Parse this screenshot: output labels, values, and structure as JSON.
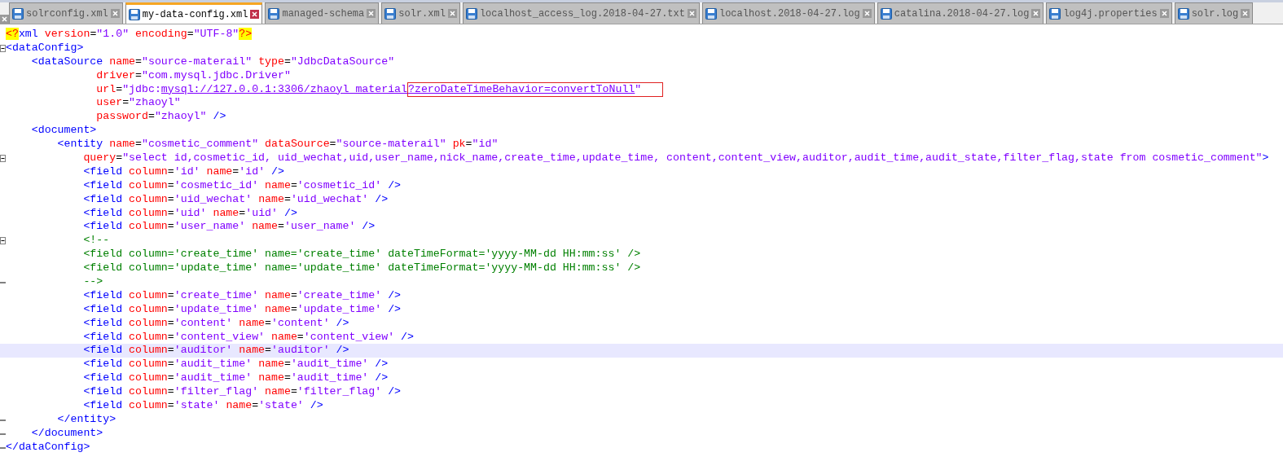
{
  "tabs": [
    {
      "label": "solrconfig.xml",
      "selected": false
    },
    {
      "label": "my-data-config.xml",
      "selected": true
    },
    {
      "label": "managed-schema",
      "selected": false
    },
    {
      "label": "solr.xml",
      "selected": false
    },
    {
      "label": "localhost_access_log.2018-04-27.txt",
      "selected": false
    },
    {
      "label": "localhost.2018-04-27.log",
      "selected": false
    },
    {
      "label": "catalina.2018-04-27.log",
      "selected": false
    },
    {
      "label": "log4j.properties",
      "selected": false
    },
    {
      "label": "solr.log",
      "selected": false
    }
  ],
  "lines": [
    {
      "current": false,
      "tokens": [
        {
          "kind": "pi",
          "text": "<?"
        },
        {
          "kind": "tag",
          "text": "xml "
        },
        {
          "kind": "attr",
          "text": "version"
        },
        {
          "kind": "op",
          "text": "="
        },
        {
          "kind": "value",
          "text": "\"1.0\" "
        },
        {
          "kind": "attr",
          "text": "encoding"
        },
        {
          "kind": "op",
          "text": "="
        },
        {
          "kind": "value",
          "text": "\"UTF-8\""
        },
        {
          "kind": "pi",
          "text": "?>"
        }
      ]
    },
    {
      "current": false,
      "kind": "fold_start",
      "tokens": [
        {
          "kind": "tag",
          "text": "<dataConfig>"
        }
      ]
    },
    {
      "current": false,
      "tokens": [
        {
          "kind": "tag",
          "text": "    <dataSource "
        },
        {
          "kind": "attr",
          "text": "name"
        },
        {
          "kind": "op",
          "text": "="
        },
        {
          "kind": "value",
          "text": "\"source-materail\" "
        },
        {
          "kind": "attr",
          "text": "type"
        },
        {
          "kind": "op",
          "text": "="
        },
        {
          "kind": "value",
          "text": "\"JdbcDataSource\""
        }
      ]
    },
    {
      "current": false,
      "tokens": [
        {
          "kind": "attr",
          "text": "              driver"
        },
        {
          "kind": "op",
          "text": "="
        },
        {
          "kind": "value",
          "text": "\"com.mysql.jdbc.Driver\""
        }
      ]
    },
    {
      "current": false,
      "tokens": [
        {
          "kind": "attr",
          "text": "              url"
        },
        {
          "kind": "op",
          "text": "="
        },
        {
          "kind": "value",
          "text": "\"jdbc:"
        },
        {
          "kind": "link",
          "text": "mysql://127.0.0.1:3306/zhaoyl_material"
        }
      ],
      "boxed": [
        {
          "kind": "link",
          "text": "?zeroDateTimeBehavior=convertToNull"
        },
        {
          "kind": "value",
          "text": "\""
        }
      ]
    },
    {
      "current": false,
      "tokens": [
        {
          "kind": "attr",
          "text": "              user"
        },
        {
          "kind": "op",
          "text": "="
        },
        {
          "kind": "value",
          "text": "\"zhaoyl\""
        }
      ]
    },
    {
      "current": false,
      "tokens": [
        {
          "kind": "attr",
          "text": "              password"
        },
        {
          "kind": "op",
          "text": "="
        },
        {
          "kind": "value",
          "text": "\"zhaoyl\" "
        },
        {
          "kind": "tag",
          "text": "/>"
        }
      ]
    },
    {
      "current": false,
      "tokens": [
        {
          "kind": "tag",
          "text": "    <document>"
        }
      ]
    },
    {
      "current": false,
      "tokens": [
        {
          "kind": "tag",
          "text": "        <entity "
        },
        {
          "kind": "attr",
          "text": "name"
        },
        {
          "kind": "op",
          "text": "="
        },
        {
          "kind": "value",
          "text": "\"cosmetic_comment\" "
        },
        {
          "kind": "attr",
          "text": "dataSource"
        },
        {
          "kind": "op",
          "text": "="
        },
        {
          "kind": "value",
          "text": "\"source-materail\" "
        },
        {
          "kind": "attr",
          "text": "pk"
        },
        {
          "kind": "op",
          "text": "="
        },
        {
          "kind": "value",
          "text": "\"id\""
        }
      ]
    },
    {
      "current": false,
      "kind": "fold_start",
      "tokens": [
        {
          "kind": "attr",
          "text": "            query"
        },
        {
          "kind": "op",
          "text": "="
        },
        {
          "kind": "value",
          "text": "\"select id,cosmetic_id, uid_wechat,uid,user_name,nick_name,create_time,update_time, content,content_view,auditor,audit_time,audit_state,filter_flag,state from cosmetic_comment\""
        },
        {
          "kind": "tag",
          "text": ">"
        }
      ]
    },
    {
      "current": false,
      "tokens": [
        {
          "kind": "tag",
          "text": "            <field "
        },
        {
          "kind": "attr",
          "text": "column"
        },
        {
          "kind": "op",
          "text": "="
        },
        {
          "kind": "value",
          "text": "'id' "
        },
        {
          "kind": "attr",
          "text": "name"
        },
        {
          "kind": "op",
          "text": "="
        },
        {
          "kind": "value",
          "text": "'id' "
        },
        {
          "kind": "tag",
          "text": "/>"
        }
      ]
    },
    {
      "current": false,
      "tokens": [
        {
          "kind": "tag",
          "text": "            <field "
        },
        {
          "kind": "attr",
          "text": "column"
        },
        {
          "kind": "op",
          "text": "="
        },
        {
          "kind": "value",
          "text": "'cosmetic_id' "
        },
        {
          "kind": "attr",
          "text": "name"
        },
        {
          "kind": "op",
          "text": "="
        },
        {
          "kind": "value",
          "text": "'cosmetic_id' "
        },
        {
          "kind": "tag",
          "text": "/>"
        }
      ]
    },
    {
      "current": false,
      "tokens": [
        {
          "kind": "tag",
          "text": "            <field "
        },
        {
          "kind": "attr",
          "text": "column"
        },
        {
          "kind": "op",
          "text": "="
        },
        {
          "kind": "value",
          "text": "'uid_wechat' "
        },
        {
          "kind": "attr",
          "text": "name"
        },
        {
          "kind": "op",
          "text": "="
        },
        {
          "kind": "value",
          "text": "'uid_wechat' "
        },
        {
          "kind": "tag",
          "text": "/>"
        }
      ]
    },
    {
      "current": false,
      "tokens": [
        {
          "kind": "tag",
          "text": "            <field "
        },
        {
          "kind": "attr",
          "text": "column"
        },
        {
          "kind": "op",
          "text": "="
        },
        {
          "kind": "value",
          "text": "'uid' "
        },
        {
          "kind": "attr",
          "text": "name"
        },
        {
          "kind": "op",
          "text": "="
        },
        {
          "kind": "value",
          "text": "'uid' "
        },
        {
          "kind": "tag",
          "text": "/>"
        }
      ]
    },
    {
      "current": false,
      "tokens": [
        {
          "kind": "tag",
          "text": "            <field "
        },
        {
          "kind": "attr",
          "text": "column"
        },
        {
          "kind": "op",
          "text": "="
        },
        {
          "kind": "value",
          "text": "'user_name' "
        },
        {
          "kind": "attr",
          "text": "name"
        },
        {
          "kind": "op",
          "text": "="
        },
        {
          "kind": "value",
          "text": "'user_name' "
        },
        {
          "kind": "tag",
          "text": "/>"
        }
      ]
    },
    {
      "current": false,
      "kind": "fold_start",
      "tokens": [
        {
          "kind": "comment",
          "text": "            <!--"
        }
      ]
    },
    {
      "current": false,
      "tokens": [
        {
          "kind": "comment",
          "text": "            <field column='create_time' name='create_time' dateTimeFormat='yyyy-MM-dd HH:mm:ss' />"
        }
      ]
    },
    {
      "current": false,
      "tokens": [
        {
          "kind": "comment",
          "text": "            <field column='update_time' name='update_time' dateTimeFormat='yyyy-MM-dd HH:mm:ss' />"
        }
      ]
    },
    {
      "current": false,
      "kind": "fold_end",
      "tokens": [
        {
          "kind": "comment",
          "text": "            -->"
        }
      ]
    },
    {
      "current": false,
      "tokens": [
        {
          "kind": "tag",
          "text": "            <field "
        },
        {
          "kind": "attr",
          "text": "column"
        },
        {
          "kind": "op",
          "text": "="
        },
        {
          "kind": "value",
          "text": "'create_time' "
        },
        {
          "kind": "attr",
          "text": "name"
        },
        {
          "kind": "op",
          "text": "="
        },
        {
          "kind": "value",
          "text": "'create_time' "
        },
        {
          "kind": "tag",
          "text": "/>"
        }
      ]
    },
    {
      "current": false,
      "tokens": [
        {
          "kind": "tag",
          "text": "            <field "
        },
        {
          "kind": "attr",
          "text": "column"
        },
        {
          "kind": "op",
          "text": "="
        },
        {
          "kind": "value",
          "text": "'update_time' "
        },
        {
          "kind": "attr",
          "text": "name"
        },
        {
          "kind": "op",
          "text": "="
        },
        {
          "kind": "value",
          "text": "'update_time' "
        },
        {
          "kind": "tag",
          "text": "/>"
        }
      ]
    },
    {
      "current": false,
      "tokens": [
        {
          "kind": "tag",
          "text": "            <field "
        },
        {
          "kind": "attr",
          "text": "column"
        },
        {
          "kind": "op",
          "text": "="
        },
        {
          "kind": "value",
          "text": "'content' "
        },
        {
          "kind": "attr",
          "text": "name"
        },
        {
          "kind": "op",
          "text": "="
        },
        {
          "kind": "value",
          "text": "'content' "
        },
        {
          "kind": "tag",
          "text": "/>"
        }
      ]
    },
    {
      "current": false,
      "tokens": [
        {
          "kind": "tag",
          "text": "            <field "
        },
        {
          "kind": "attr",
          "text": "column"
        },
        {
          "kind": "op",
          "text": "="
        },
        {
          "kind": "value",
          "text": "'content_view' "
        },
        {
          "kind": "attr",
          "text": "name"
        },
        {
          "kind": "op",
          "text": "="
        },
        {
          "kind": "value",
          "text": "'content_view' "
        },
        {
          "kind": "tag",
          "text": "/>"
        }
      ]
    },
    {
      "current": true,
      "tokens": [
        {
          "kind": "tag",
          "text": "            <field "
        },
        {
          "kind": "attr",
          "text": "column"
        },
        {
          "kind": "op",
          "text": "="
        },
        {
          "kind": "value",
          "text": "'auditor' "
        },
        {
          "kind": "attr",
          "text": "name"
        },
        {
          "kind": "op",
          "text": "="
        },
        {
          "kind": "value",
          "text": "'auditor' "
        },
        {
          "kind": "tag",
          "text": "/>"
        }
      ]
    },
    {
      "current": false,
      "tokens": [
        {
          "kind": "tag",
          "text": "            <field "
        },
        {
          "kind": "attr",
          "text": "column"
        },
        {
          "kind": "op",
          "text": "="
        },
        {
          "kind": "value",
          "text": "'audit_time' "
        },
        {
          "kind": "attr",
          "text": "name"
        },
        {
          "kind": "op",
          "text": "="
        },
        {
          "kind": "value",
          "text": "'audit_time' "
        },
        {
          "kind": "tag",
          "text": "/>"
        }
      ]
    },
    {
      "current": false,
      "tokens": [
        {
          "kind": "tag",
          "text": "            <field "
        },
        {
          "kind": "attr",
          "text": "column"
        },
        {
          "kind": "op",
          "text": "="
        },
        {
          "kind": "value",
          "text": "'audit_time' "
        },
        {
          "kind": "attr",
          "text": "name"
        },
        {
          "kind": "op",
          "text": "="
        },
        {
          "kind": "value",
          "text": "'audit_time' "
        },
        {
          "kind": "tag",
          "text": "/>"
        }
      ]
    },
    {
      "current": false,
      "tokens": [
        {
          "kind": "tag",
          "text": "            <field "
        },
        {
          "kind": "attr",
          "text": "column"
        },
        {
          "kind": "op",
          "text": "="
        },
        {
          "kind": "value",
          "text": "'filter_flag' "
        },
        {
          "kind": "attr",
          "text": "name"
        },
        {
          "kind": "op",
          "text": "="
        },
        {
          "kind": "value",
          "text": "'filter_flag' "
        },
        {
          "kind": "tag",
          "text": "/>"
        }
      ]
    },
    {
      "current": false,
      "tokens": [
        {
          "kind": "tag",
          "text": "            <field "
        },
        {
          "kind": "attr",
          "text": "column"
        },
        {
          "kind": "op",
          "text": "="
        },
        {
          "kind": "value",
          "text": "'state' "
        },
        {
          "kind": "attr",
          "text": "name"
        },
        {
          "kind": "op",
          "text": "="
        },
        {
          "kind": "value",
          "text": "'state' "
        },
        {
          "kind": "tag",
          "text": "/>"
        }
      ]
    },
    {
      "current": false,
      "kind": "fold_end",
      "tokens": [
        {
          "kind": "tag",
          "text": "        </entity>"
        }
      ]
    },
    {
      "current": false,
      "kind": "fold_end",
      "tokens": [
        {
          "kind": "tag",
          "text": "    </document>"
        }
      ]
    },
    {
      "current": false,
      "kind": "fold_end",
      "tokens": [
        {
          "kind": "tag",
          "text": "</dataConfig>"
        }
      ]
    }
  ]
}
